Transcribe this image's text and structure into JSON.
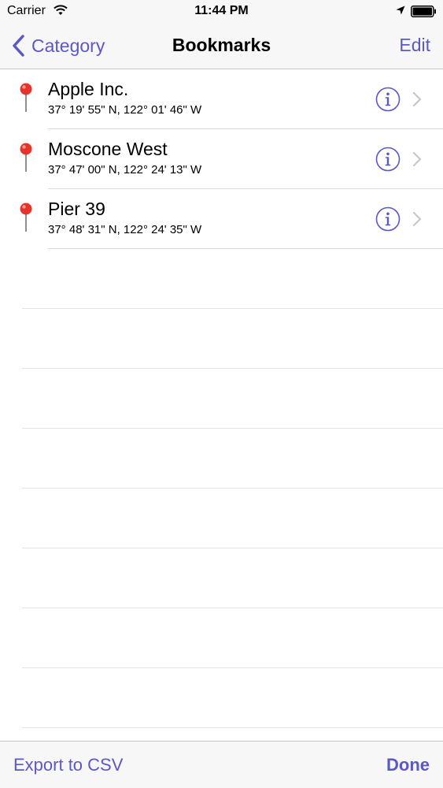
{
  "status_bar": {
    "carrier": "Carrier",
    "time": "11:44 PM",
    "icons": [
      "wifi-icon",
      "location-arrow-icon",
      "battery-icon"
    ]
  },
  "nav": {
    "back_label": "Category",
    "title": "Bookmarks",
    "edit_label": "Edit"
  },
  "bookmarks": [
    {
      "name": "Apple Inc.",
      "coords": "37° 19' 55\" N, 122° 01' 46\" W",
      "icon": "pin-icon"
    },
    {
      "name": "Moscone West",
      "coords": "37° 47' 00\" N, 122° 24' 13\" W",
      "icon": "pin-icon"
    },
    {
      "name": "Pier 39",
      "coords": "37° 48' 31\" N, 122° 24' 35\" W",
      "icon": "pin-icon"
    }
  ],
  "toolbar": {
    "export_label": "Export to CSV",
    "done_label": "Done"
  },
  "colors": {
    "tint": "#5b58c7",
    "pin_head": "#e8332a",
    "bar_background": "#f7f7f7",
    "separator": "#dcdce0"
  }
}
